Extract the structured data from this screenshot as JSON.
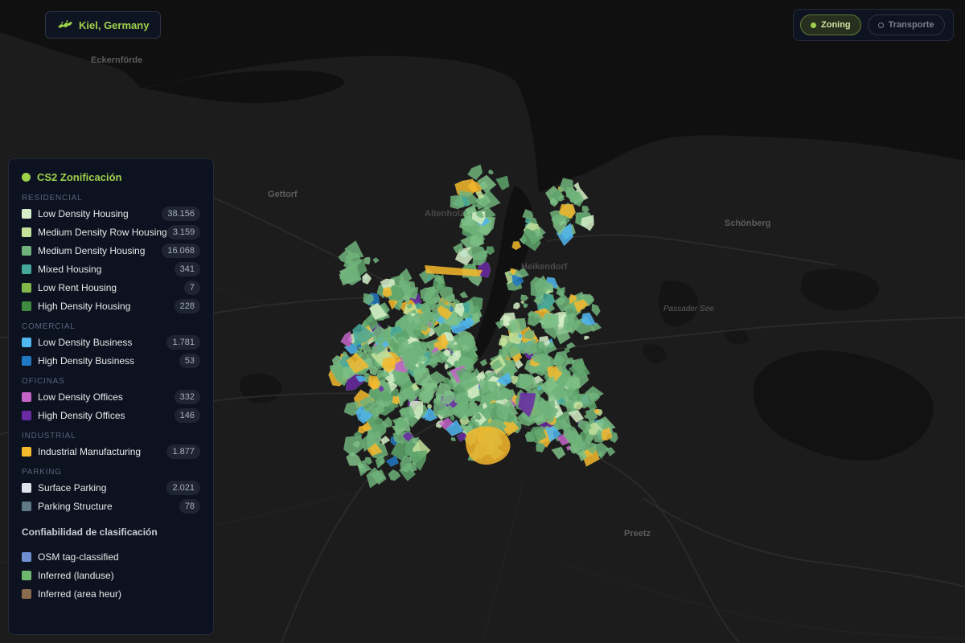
{
  "city": {
    "name": "Kiel, Germany",
    "icon": "kiel-flag-icon"
  },
  "layers": {
    "zoning": {
      "label": "Zoning",
      "active": true
    },
    "transport": {
      "label": "Transporte",
      "active": false
    }
  },
  "map_labels": {
    "eckernforde": "Eckernförde",
    "gettorf": "Gettorf",
    "schonberg": "Schönberg",
    "preetz": "Preetz",
    "passader_see": "Passader See",
    "altenholz": "Altenholz",
    "heikendorf": "Heikendorf"
  },
  "legend": {
    "title": "CS2 Zonificación",
    "sections": {
      "residencial": {
        "label": "RESIDENCIAL",
        "items": [
          {
            "label": "Low Density Housing",
            "count": "38.156",
            "color": "#d6eec8"
          },
          {
            "label": "Medium Density Row Housing",
            "count": "3.159",
            "color": "#c4e39b"
          },
          {
            "label": "Medium Density Housing",
            "count": "16.068",
            "color": "#6fb37a"
          },
          {
            "label": "Mixed Housing",
            "count": "341",
            "color": "#44a89a"
          },
          {
            "label": "Low Rent Housing",
            "count": "7",
            "color": "#82b84a"
          },
          {
            "label": "High Density Housing",
            "count": "228",
            "color": "#3f8a3e"
          }
        ]
      },
      "comercial": {
        "label": "COMERCIAL",
        "items": [
          {
            "label": "Low Density Business",
            "count": "1.781",
            "color": "#4fb6f2"
          },
          {
            "label": "High Density Business",
            "count": "53",
            "color": "#1f78c4"
          }
        ]
      },
      "oficinas": {
        "label": "OFICINAS",
        "items": [
          {
            "label": "Low Density Offices",
            "count": "332",
            "color": "#c464c8"
          },
          {
            "label": "High Density Offices",
            "count": "146",
            "color": "#6a2aa4"
          }
        ]
      },
      "industrial": {
        "label": "INDUSTRIAL",
        "items": [
          {
            "label": "Industrial Manufacturing",
            "count": "1.877",
            "color": "#f6b92c"
          }
        ]
      },
      "parking": {
        "label": "PARKING",
        "items": [
          {
            "label": "Surface Parking",
            "count": "2.021",
            "color": "#dfe4ea"
          },
          {
            "label": "Parking Structure",
            "count": "78",
            "color": "#5f7a86"
          }
        ]
      }
    },
    "confidence": {
      "title": "Confiabilidad de clasificación",
      "items": [
        {
          "label": "OSM tag-classified",
          "color": "#6f8fd0"
        },
        {
          "label": "Inferred (landuse)",
          "color": "#6db86d"
        },
        {
          "label": "Inferred (area heur)",
          "color": "#8a6d4e"
        }
      ]
    }
  }
}
